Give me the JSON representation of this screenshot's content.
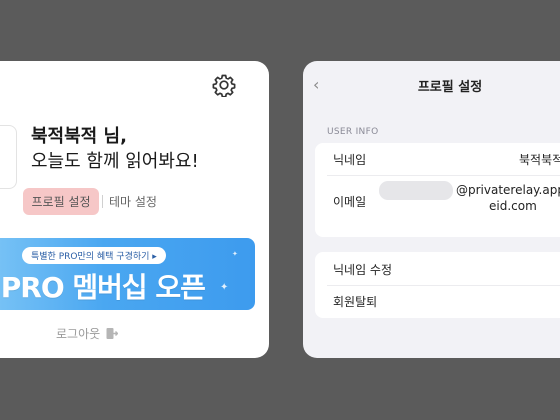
{
  "home": {
    "greeting_name": "북적북적 님,",
    "greeting_message": "오늘도 함께 읽어봐요!",
    "profile_settings_label": "프로필 설정",
    "theme_settings_label": "테마 설정",
    "banner": {
      "pill_text": "특별한 PRO만의 혜택 구경하기 ▸",
      "title": "적PRO 멤버십 오픈"
    },
    "logout_label": "로그아웃",
    "icons": [
      "gear-icon",
      "logout-icon"
    ]
  },
  "profile": {
    "back_icon": "‹",
    "title": "프로필 설정",
    "section_label": "USER INFO",
    "nickname_label": "닉네임",
    "nickname_value": "북적북적",
    "email_label": "이메일",
    "email_value_line1": "@privaterelay.app",
    "email_value_line2": "eid.com",
    "edit_nickname_label": "닉네임 수정",
    "withdraw_label": "회원탈퇴"
  },
  "colors": {
    "background": "#5b5b5b",
    "profile_button_bg": "#f6c7c7",
    "banner_start": "#7ec6f6",
    "banner_end": "#3d9bee",
    "settings_bg": "#f2f2f6"
  }
}
